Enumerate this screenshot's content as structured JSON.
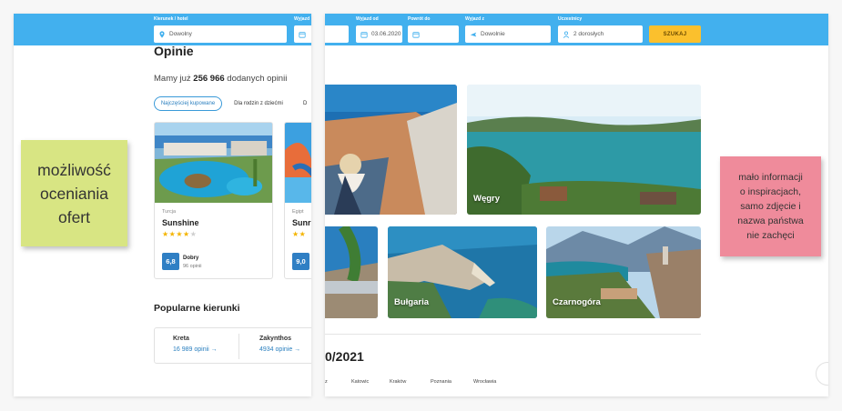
{
  "search_bar": {
    "destination_label": "Kierunek / hotel",
    "destination_value": "Dowolny",
    "departure_label_partial": "Wyjazd",
    "departure_label": "Wyjazd od",
    "departure_value": "03.06.2020",
    "return_label": "Powrót do",
    "return_value": "",
    "from_label": "Wyjazd z",
    "from_value": "Dowolnie",
    "participants_label": "Uczestnicy",
    "participants_value": "2 dorosłych",
    "search_button": "SZUKAJ"
  },
  "reviews": {
    "title": "Opinie",
    "count_prefix": "Mamy już",
    "count": "256 966",
    "count_suffix": "dodanych opinii",
    "filters": [
      "Najczęściej kupowane",
      "Dla rodzin z dziećmi"
    ],
    "cards": [
      {
        "country": "Turcja",
        "hotel": "Sunshine",
        "stars_on": "★★★★",
        "stars_off": "★",
        "score": "6,8",
        "rating_word": "Dobry",
        "rating_count": "96 opinii"
      },
      {
        "country": "Egipt",
        "hotel": "Sunri",
        "stars_on": "★★",
        "stars_off": "",
        "score": "9,0",
        "rating_word": "",
        "rating_count": ""
      }
    ]
  },
  "popular": {
    "title": "Popularne kierunki",
    "items": [
      {
        "name": "Kreta",
        "count": "16 989",
        "link": "opinii →"
      },
      {
        "name": "Zakynthos",
        "count": "4934",
        "link": "opinie →"
      }
    ]
  },
  "destinations": {
    "tiles": [
      "Węgry",
      "Bułgaria",
      "Czarnogóra"
    ]
  },
  "season": {
    "title": "0/2021",
    "cities": [
      "Katowic",
      "Kraków",
      "Poznania",
      "Wrocławia"
    ]
  },
  "notes": {
    "green": [
      "możliwość",
      "oceniania",
      "ofert"
    ],
    "pink": [
      "mało informacji",
      "o inspiracjach,",
      "samo zdjęcie i",
      "nazwa państwa",
      "nie zachęci"
    ]
  },
  "colors": {
    "search_bar": "#42b0ee",
    "search_button": "#fbc02d",
    "score_badge": "#2f7fc4",
    "note_green": "#d8e583",
    "note_pink": "#ef8b9b"
  }
}
